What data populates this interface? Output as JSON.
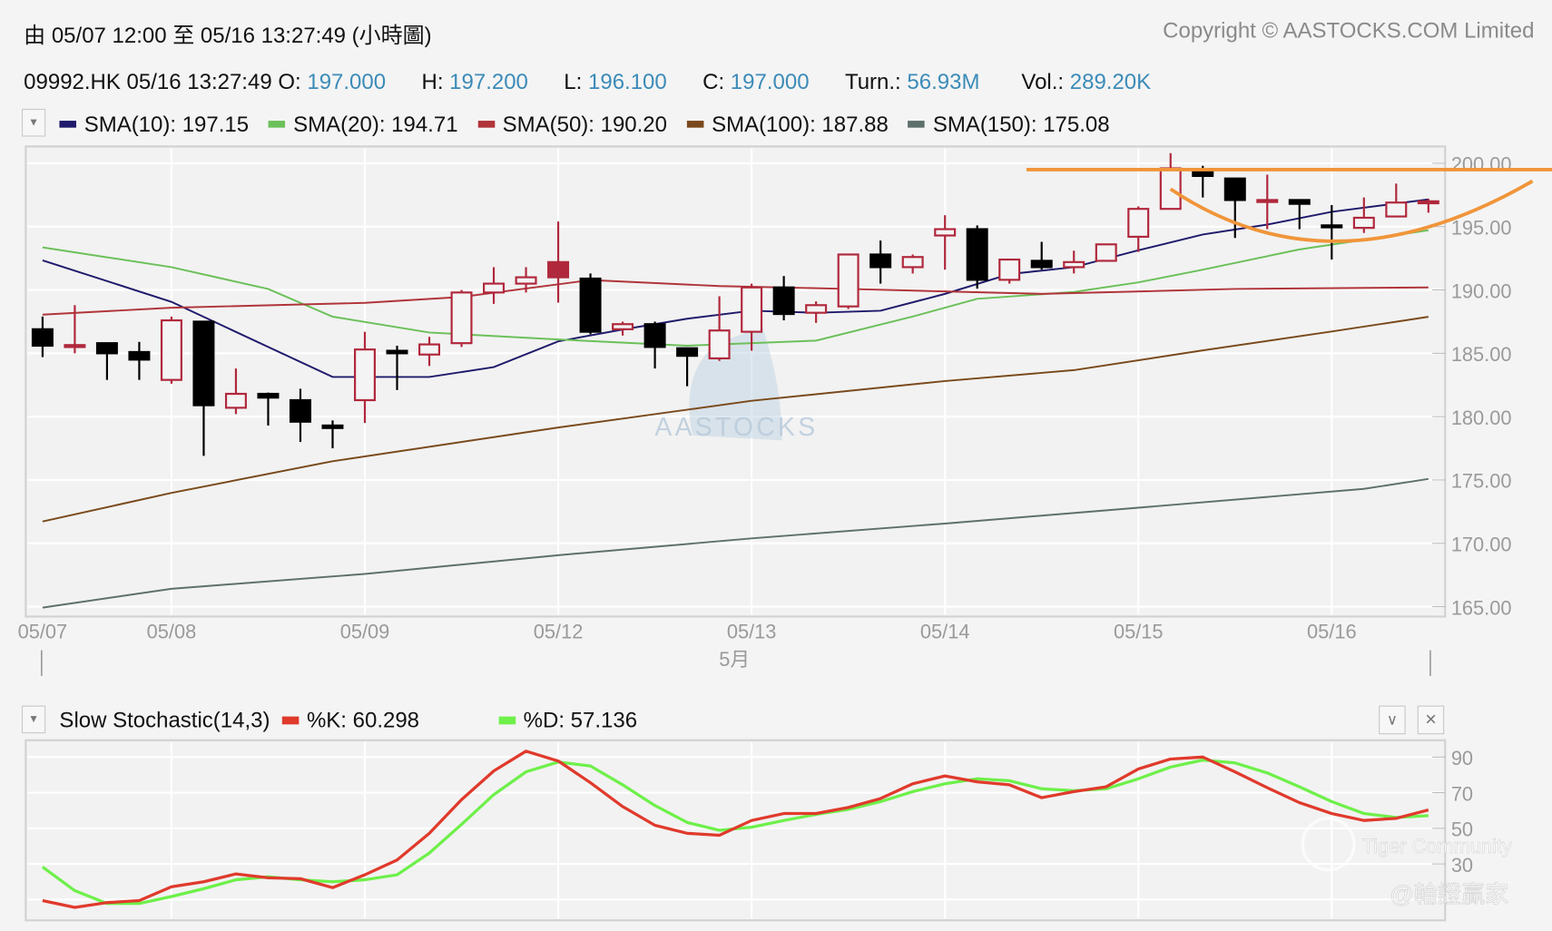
{
  "header": {
    "range_title": "由  05/07 12:00 至  05/16 13:27:49 (小時圖)",
    "copyright": "Copyright © AASTOCKS.COM Limited"
  },
  "quote": {
    "symbol_time": "09992.HK 05/16 13:27:49",
    "open_label": "O:",
    "open": "197.000",
    "high_label": "H:",
    "high": "197.200",
    "low_label": "L:",
    "low": "196.100",
    "close_label": "C:",
    "close": "197.000",
    "turnover_label": "Turn.:",
    "turnover": "56.93M",
    "volume_label": "Vol.:",
    "volume": "289.20K"
  },
  "legend": [
    {
      "label": "SMA(10): 197.15",
      "color": "#1f1a6b"
    },
    {
      "label": "SMA(20): 194.71",
      "color": "#6cc05a"
    },
    {
      "label": "SMA(50): 190.20",
      "color": "#b0353a"
    },
    {
      "label": "SMA(100): 187.88",
      "color": "#7a4a1c"
    },
    {
      "label": "SMA(150): 175.08",
      "color": "#5e706c"
    }
  ],
  "indicator": {
    "title": "Slow Stochastic(14,3)",
    "k_label": "%K: 60.298",
    "k_color": "#e03a2c",
    "d_label": "%D: 57.136",
    "d_color": "#6ef04a",
    "collapse_icon": "chevron-down-icon",
    "close_icon": "close-icon"
  },
  "watermarks": {
    "center": "AASTOCKS",
    "tiger": "Tiger Community",
    "author": "@輪證贏家"
  },
  "colors": {
    "up": "#b0283c",
    "down": "#000000",
    "annotation": "#f0953a",
    "accent": "#3b8bb8"
  },
  "chart_data": [
    {
      "type": "candlestick",
      "title": "09992.HK hourly",
      "ylim": [
        164.5,
        201.5
      ],
      "y_ticks": [
        "200.00",
        "195.00",
        "190.00",
        "185.00",
        "180.00",
        "175.00",
        "170.00",
        "165.00"
      ],
      "x_labels": [
        {
          "label": "05/07",
          "index": 0
        },
        {
          "label": "05/08",
          "index": 4
        },
        {
          "label": "05/09",
          "index": 10
        },
        {
          "label": "05/12",
          "index": 16
        },
        {
          "label": "05/13",
          "index": 22
        },
        {
          "label": "05/14",
          "index": 28
        },
        {
          "label": "05/15",
          "index": 34
        },
        {
          "label": "05/16",
          "index": 40
        }
      ],
      "month_label": "5月",
      "candles": [
        [
          186.9,
          187.9,
          184.7,
          185.6
        ],
        [
          185.6,
          188.8,
          185.0,
          185.65
        ],
        [
          185.8,
          185.8,
          182.9,
          185.0
        ],
        [
          185.1,
          185.9,
          182.9,
          184.5
        ],
        [
          182.9,
          187.9,
          182.6,
          187.6
        ],
        [
          187.5,
          187.5,
          176.9,
          180.9
        ],
        [
          180.7,
          183.8,
          180.2,
          181.8
        ],
        [
          181.8,
          181.9,
          179.3,
          181.5
        ],
        [
          181.3,
          182.2,
          178.0,
          179.6
        ],
        [
          179.3,
          179.7,
          177.5,
          179.1
        ],
        [
          181.3,
          186.7,
          179.5,
          185.3
        ],
        [
          185.2,
          185.6,
          182.1,
          185.0
        ],
        [
          184.9,
          186.3,
          184.0,
          185.7
        ],
        [
          185.8,
          190.0,
          185.5,
          189.8
        ],
        [
          189.8,
          191.8,
          188.9,
          190.5
        ],
        [
          190.5,
          191.8,
          189.8,
          191.0
        ],
        [
          191.0,
          195.4,
          189.0,
          192.2
        ],
        [
          190.9,
          191.3,
          186.5,
          186.7
        ],
        [
          186.9,
          187.5,
          186.4,
          187.3
        ],
        [
          187.3,
          187.5,
          183.8,
          185.5
        ],
        [
          185.4,
          185.4,
          182.4,
          184.8
        ],
        [
          184.6,
          189.5,
          184.4,
          186.8
        ],
        [
          186.7,
          190.5,
          185.2,
          190.2
        ],
        [
          190.2,
          191.1,
          187.6,
          188.1
        ],
        [
          188.2,
          189.1,
          187.4,
          188.8
        ],
        [
          188.7,
          192.8,
          188.5,
          192.8
        ],
        [
          192.8,
          193.9,
          190.5,
          191.8
        ],
        [
          191.8,
          192.8,
          191.3,
          192.6
        ],
        [
          194.3,
          195.9,
          191.6,
          194.8
        ],
        [
          194.8,
          195.1,
          190.1,
          190.8
        ],
        [
          190.8,
          192.4,
          190.5,
          192.4
        ],
        [
          192.3,
          193.8,
          191.6,
          191.8
        ],
        [
          191.8,
          193.1,
          191.3,
          192.2
        ],
        [
          192.3,
          193.6,
          192.3,
          193.6
        ],
        [
          194.2,
          196.6,
          193.0,
          196.4
        ],
        [
          196.4,
          200.8,
          196.4,
          199.6
        ],
        [
          199.4,
          199.8,
          197.3,
          199.0
        ],
        [
          198.8,
          198.8,
          194.1,
          197.1
        ],
        [
          197.0,
          199.1,
          194.8,
          197.1
        ],
        [
          197.1,
          197.1,
          194.8,
          196.8
        ],
        [
          195.1,
          196.7,
          192.4,
          195.0
        ],
        [
          194.9,
          197.3,
          194.5,
          195.7
        ],
        [
          195.8,
          198.4,
          195.8,
          196.9
        ],
        [
          196.9,
          197.2,
          196.1,
          197.0
        ]
      ],
      "candle_fields": [
        "open",
        "high",
        "low",
        "close"
      ],
      "filled_up_indices": [
        16
      ],
      "series": [
        {
          "name": "SMA(10)",
          "color": "#1f1a6b",
          "points": [
            [
              0,
              192.34
            ],
            [
              4,
              189.06
            ],
            [
              9,
              183.13
            ],
            [
              12,
              183.13
            ],
            [
              14,
              183.91
            ],
            [
              16,
              185.94
            ],
            [
              18,
              186.88
            ],
            [
              20,
              187.73
            ],
            [
              22,
              188.36
            ],
            [
              24,
              188.2
            ],
            [
              26,
              188.36
            ],
            [
              28,
              189.69
            ],
            [
              30,
              191.25
            ],
            [
              32,
              191.8
            ],
            [
              34,
              193.13
            ],
            [
              36,
              194.38
            ],
            [
              38,
              195.16
            ],
            [
              40,
              196.17
            ],
            [
              43,
              197.15
            ]
          ]
        },
        {
          "name": "SMA(20)",
          "color": "#6cc05a",
          "points": [
            [
              0,
              193.36
            ],
            [
              4,
              191.8
            ],
            [
              7,
              190.08
            ],
            [
              9,
              187.89
            ],
            [
              12,
              186.64
            ],
            [
              16,
              186.09
            ],
            [
              20,
              185.6
            ],
            [
              24,
              186.0
            ],
            [
              27,
              187.9
            ],
            [
              29,
              189.3
            ],
            [
              32,
              189.84
            ],
            [
              34,
              190.6
            ],
            [
              36,
              191.6
            ],
            [
              39,
              193.2
            ],
            [
              43,
              194.71
            ]
          ]
        },
        {
          "name": "SMA(50)",
          "color": "#b0353a",
          "points": [
            [
              0,
              188.05
            ],
            [
              4,
              188.6
            ],
            [
              10,
              188.98
            ],
            [
              13,
              189.45
            ],
            [
              17,
              190.78
            ],
            [
              21,
              190.31
            ],
            [
              25,
              190.08
            ],
            [
              31,
              189.69
            ],
            [
              37,
              190.08
            ],
            [
              43,
              190.2
            ]
          ]
        },
        {
          "name": "SMA(100)",
          "color": "#7a4a1c",
          "points": [
            [
              0,
              171.72
            ],
            [
              4,
              173.98
            ],
            [
              9,
              176.48
            ],
            [
              16,
              179.14
            ],
            [
              22,
              181.25
            ],
            [
              28,
              182.81
            ],
            [
              32,
              183.67
            ],
            [
              36,
              185.23
            ],
            [
              40,
              186.72
            ],
            [
              43,
              187.88
            ]
          ]
        },
        {
          "name": "SMA(150)",
          "color": "#5e706c",
          "points": [
            [
              0,
              164.92
            ],
            [
              4,
              166.41
            ],
            [
              10,
              167.58
            ],
            [
              16,
              169.06
            ],
            [
              22,
              170.39
            ],
            [
              28,
              171.56
            ],
            [
              34,
              172.81
            ],
            [
              41,
              174.3
            ],
            [
              43,
              175.08
            ]
          ]
        }
      ],
      "annotations": {
        "resistance_price": 199.5,
        "cup_from_index": 35,
        "cup_bottom": [
          40,
          193.8
        ],
        "cup_to_index": 45
      }
    },
    {
      "type": "line",
      "title": "Slow Stochastic(14,3)",
      "ylim": [
        0,
        100
      ],
      "y_ticks": [
        "90",
        "70",
        "50",
        "30"
      ],
      "series": [
        {
          "name": "%K",
          "color": "#e03a2c",
          "values": [
            9.4,
            5.6,
            8.3,
            9.4,
            17.2,
            20,
            24.4,
            22.2,
            21.7,
            16.7,
            23.9,
            32.2,
            47.2,
            66.1,
            82.2,
            93.3,
            87.8,
            75.6,
            62.2,
            51.7,
            47.2,
            46.1,
            54.4,
            58.3,
            58.3,
            61.7,
            66.7,
            75,
            79.4,
            76.1,
            74.4,
            67.2,
            70.6,
            73.3,
            83.3,
            88.9,
            90,
            81.7,
            72.8,
            64.4,
            58.3,
            54.4,
            55.6,
            60.3
          ]
        },
        {
          "name": "%D",
          "color": "#6ef04a",
          "values": [
            28.3,
            15,
            7.8,
            7.8,
            11.7,
            16.1,
            21.1,
            22.8,
            21.1,
            20,
            21.1,
            23.9,
            36.1,
            52.2,
            68.9,
            81.7,
            87.2,
            85,
            74.4,
            62.8,
            53.3,
            48.9,
            50.6,
            54.4,
            57.8,
            60.6,
            65,
            70.6,
            75,
            77.8,
            76.7,
            72.2,
            71.1,
            72.2,
            77.8,
            84.4,
            88.3,
            86.7,
            81.1,
            73.3,
            65,
            58.3,
            56.1,
            57.1
          ]
        }
      ]
    }
  ]
}
